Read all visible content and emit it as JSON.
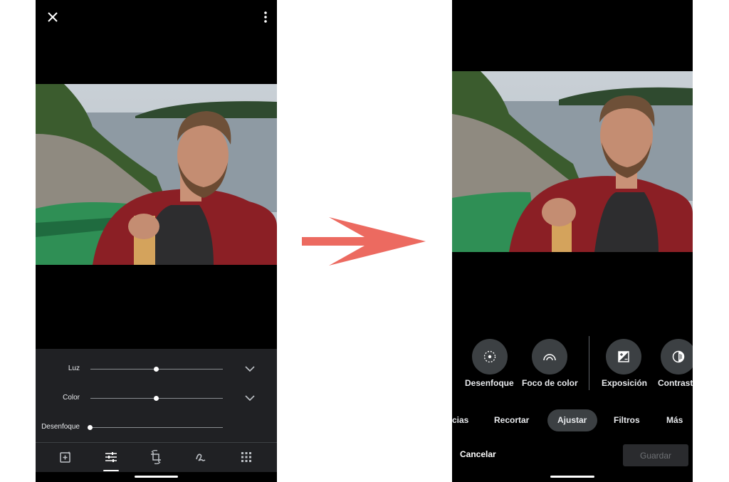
{
  "left_screen": {
    "sliders": [
      {
        "label": "Luz",
        "level": 0.5,
        "has_expand": true
      },
      {
        "label": "Color",
        "level": 0.5,
        "has_expand": true
      },
      {
        "label": "Desenfoque",
        "level": 0.0,
        "has_expand": false
      }
    ],
    "toolbar_icons": [
      "add-photo-icon",
      "adjust-sliders-icon",
      "crop-rotate-icon",
      "markup-icon",
      "more-tools-icon"
    ],
    "active_tool": "adjust-sliders-icon"
  },
  "right_screen": {
    "tools": [
      {
        "label": "Desenfoque",
        "icon": "blur-icon"
      },
      {
        "label": "Foco de color",
        "icon": "color-focus-icon"
      },
      {
        "label": "Exposición",
        "icon": "exposure-icon"
      },
      {
        "label": "Contrast",
        "icon": "contrast-icon"
      }
    ],
    "tabs": [
      {
        "label": "cias"
      },
      {
        "label": "Recortar"
      },
      {
        "label": "Ajustar",
        "active": true
      },
      {
        "label": "Filtros"
      },
      {
        "label": "Más"
      }
    ],
    "cancel_label": "Cancelar",
    "save_label": "Guardar"
  },
  "colors": {
    "arrow": "#ec6a60",
    "panel": "#202124",
    "chip": "#3c4043"
  }
}
